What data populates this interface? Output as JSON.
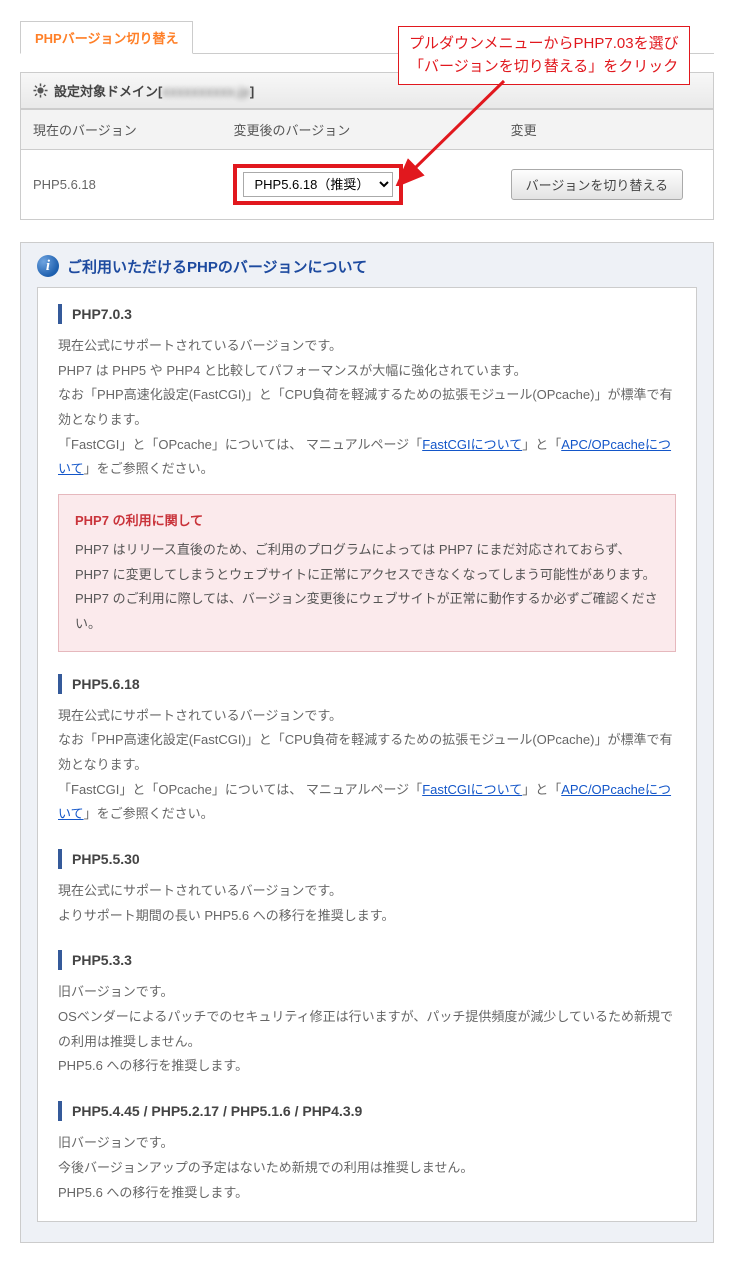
{
  "tab": "PHPバージョン切り替え",
  "domain_bar": {
    "label": "設定対象ドメイン",
    "domain_masked": "xxxxxxxxxx.jp"
  },
  "annotation": {
    "line1": "プルダウンメニューからPHP7.03を選び",
    "line2": "「バージョンを切り替える」をクリック"
  },
  "table": {
    "headers": {
      "current": "現在のバージョン",
      "after": "変更後のバージョン",
      "change": "変更"
    },
    "row": {
      "current": "PHP5.6.18",
      "selected": "PHP5.6.18（推奨）",
      "button": "バージョンを切り替える"
    }
  },
  "info_panel": {
    "title": "ご利用いただけるPHPのバージョンについて",
    "icon": "i",
    "link_fastcgi": "FastCGIについて",
    "link_opcache": "APC/OPcacheについて",
    "sections": {
      "php703": {
        "title": "PHP7.0.3",
        "p1": "現在公式にサポートされているバージョンです。",
        "p2": "PHP7 は PHP5 や PHP4 と比較してパフォーマンスが大幅に強化されています。",
        "p3": "なお「PHP高速化設定(FastCGI)」と「CPU負荷を軽減するための拡張モジュール(OPcache)」が標準で有効となります。",
        "p4a": "「FastCGI」と「OPcache」については、 マニュアルページ「",
        "p4b": "」と「",
        "p4c": "」をご参照ください。",
        "alert_title": "PHP7 の利用に関して",
        "alert1": "PHP7 はリリース直後のため、ご利用のプログラムによっては PHP7 にまだ対応されておらず、PHP7 に変更してしまうとウェブサイトに正常にアクセスできなくなってしまう可能性があります。",
        "alert2": "PHP7 のご利用に際しては、バージョン変更後にウェブサイトが正常に動作するか必ずご確認ください。"
      },
      "php5618": {
        "title": "PHP5.6.18",
        "p1": "現在公式にサポートされているバージョンです。",
        "p2": "なお「PHP高速化設定(FastCGI)」と「CPU負荷を軽減するための拡張モジュール(OPcache)」が標準で有効となります。",
        "p3a": "「FastCGI」と「OPcache」については、 マニュアルページ「",
        "p3b": "」と「",
        "p3c": "」をご参照ください。"
      },
      "php5530": {
        "title": "PHP5.5.30",
        "p1": "現在公式にサポートされているバージョンです。",
        "p2": "よりサポート期間の長い PHP5.6 への移行を推奨します。"
      },
      "php533": {
        "title": "PHP5.3.3",
        "p1": "旧バージョンです。",
        "p2": "OSベンダーによるパッチでのセキュリティ修正は行いますが、パッチ提供頻度が減少しているため新規での利用は推奨しません。",
        "p3": "PHP5.6 への移行を推奨します。"
      },
      "php5445": {
        "title": "PHP5.4.45 / PHP5.2.17 / PHP5.1.6 / PHP4.3.9",
        "p1": "旧バージョンです。",
        "p2": "今後バージョンアップの予定はないため新規での利用は推奨しません。",
        "p3": "PHP5.6 への移行を推奨します。"
      }
    }
  }
}
